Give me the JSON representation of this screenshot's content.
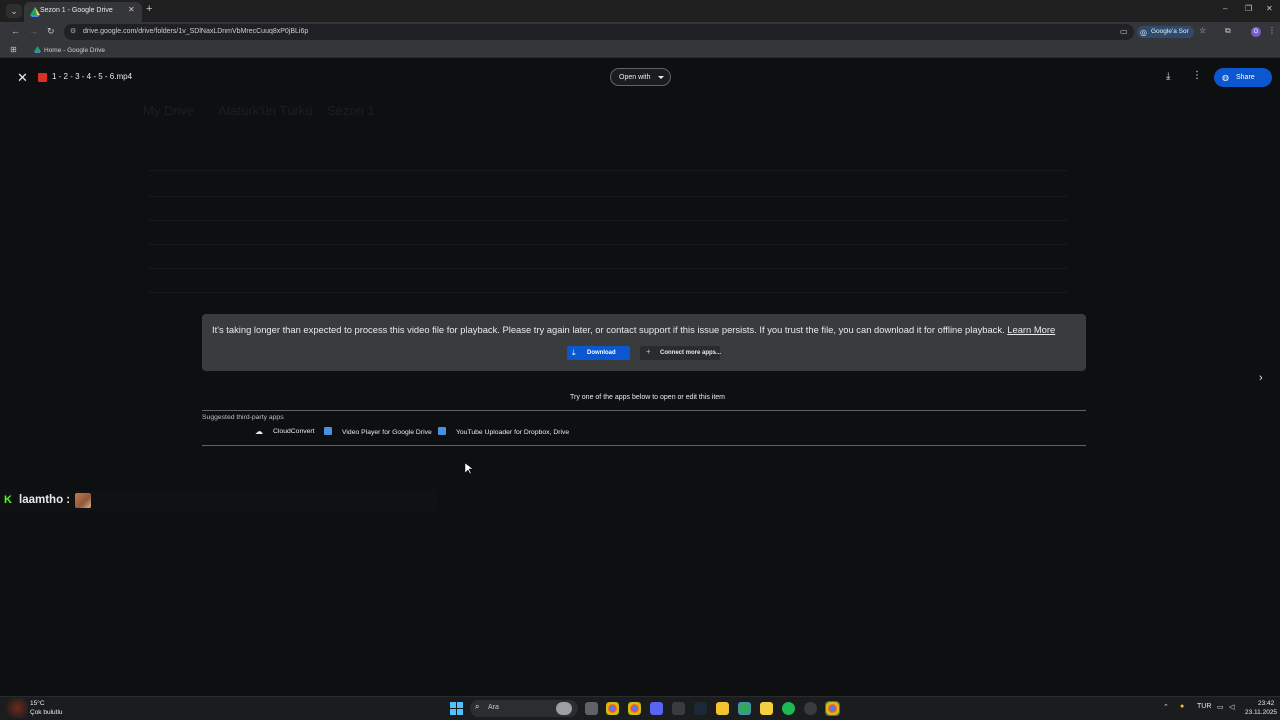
{
  "browser": {
    "tab_title": "Sezon 1 - Google Drive",
    "url": "drive.google.com/drive/folders/1v_SDlNaxLDnmVbMrecCuuq8xP0jBLi6p",
    "google_sor": "Google'a Sor",
    "profile_initial": "G",
    "bookmark": "Home - Google Drive",
    "window_controls": [
      "–",
      "❐",
      "✕"
    ]
  },
  "viewer": {
    "file_name": "1 - 2 - 3 - 4 - 5 - 6.mp4",
    "open_with": "Open with",
    "share": "Share"
  },
  "error": {
    "message": "It's taking longer than expected to process this video file for playback. Please try again later, or contact support if this issue persists. If you trust the file, you can download it for offline playback.",
    "learn_more": "Learn More",
    "download": "Download",
    "connect_more": "Connect more apps..."
  },
  "apps": {
    "try_text": "Try one of the apps below to open or edit this item",
    "suggested_label": "Suggested third-party apps",
    "items": [
      {
        "name": "CloudConvert",
        "icon": "cloud-icon",
        "color": "#e8eaed"
      },
      {
        "name": "Video Player for Google Drive",
        "icon": "video-player-icon",
        "color": "#4a90e2"
      },
      {
        "name": "YouTube Uploader for Dropbox, Drive",
        "icon": "youtube-uploader-icon",
        "color": "#4a90e2"
      }
    ]
  },
  "chat": {
    "username": "laamtho :"
  },
  "background": {
    "breadcrumb": [
      "My Drive",
      "Atatürk'ün Türkü",
      "Sezon 1"
    ]
  },
  "taskbar": {
    "temperature": "15°C",
    "condition": "Çok bulutlu",
    "search_placeholder": "Ara",
    "language": "TUR",
    "time": "23:42",
    "date": "23.11.2025"
  },
  "colors": {
    "accent": "#0b57d0",
    "banner": "#3a3b3d",
    "kick_green": "#53fc18"
  }
}
